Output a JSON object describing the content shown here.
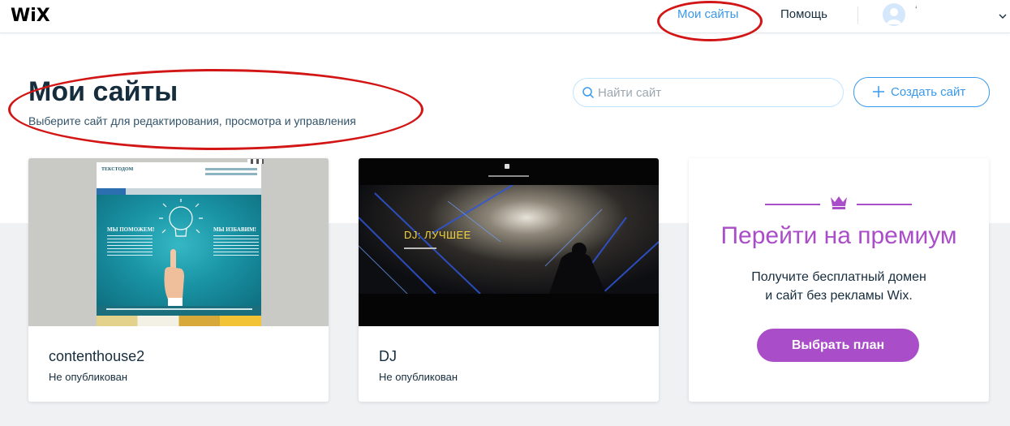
{
  "topbar": {
    "logo": "WiX",
    "nav_my_sites": "Мои сайты",
    "nav_help": "Помощь",
    "username": "‘"
  },
  "header": {
    "title": "Мои сайты",
    "subtitle": "Выберите сайт для редактирования, просмотра и управления",
    "search_placeholder": "Найти сайт",
    "create_label": "Создать сайт"
  },
  "sites": [
    {
      "name": "contenthouse2",
      "status": "Не опубликован",
      "thumb": {
        "brand": "ТЕКСТОДОМ",
        "headline_left": "МЫ ПОМОЖЕМ!",
        "headline_right": "МЫ ИЗБАВИМ!"
      }
    },
    {
      "name": "DJ",
      "status": "Не опубликован",
      "thumb": {
        "headline": "DJ: ЛУЧШЕЕ"
      }
    }
  ],
  "premium": {
    "title": "Перейти на премиум",
    "desc_line1": "Получите бесплатный домен",
    "desc_line2": "и сайт без рекламы Wix.",
    "button_label": "Выбрать план"
  },
  "colors": {
    "accent_blue": "#3899ec",
    "premium_purple": "#aa4dc8",
    "annotation_red": "#d21515"
  },
  "icons": {
    "search": "search-icon",
    "plus": "plus-icon",
    "crown": "crown-icon",
    "avatar": "avatar-icon",
    "caret": "chevron-down-icon"
  }
}
